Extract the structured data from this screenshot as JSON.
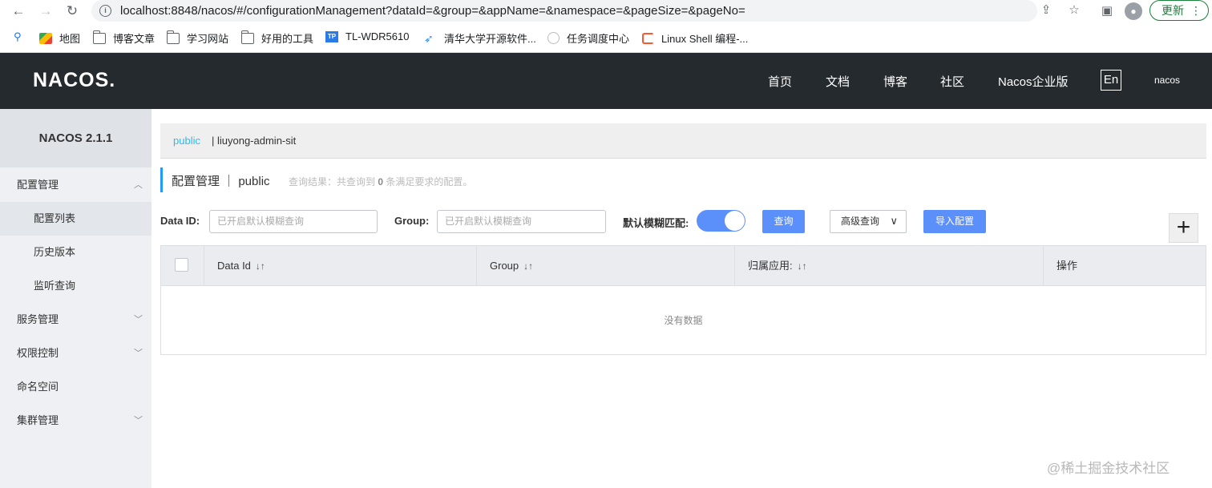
{
  "browser": {
    "url": "localhost:8848/nacos/#/configurationManagement?dataId=&group=&appName=&namespace=&pageSize=&pageNo=",
    "update_label": "更新",
    "bookmarks": [
      "地图",
      "博客文章",
      "学习网站",
      "好用的工具",
      "TL-WDR5610",
      "清华大学开源软件...",
      "任务调度中心",
      "Linux Shell 编程-..."
    ]
  },
  "header": {
    "logo": "NACOS.",
    "nav": [
      "首页",
      "文档",
      "博客",
      "社区",
      "Nacos企业版"
    ],
    "lang": "En",
    "user": "nacos"
  },
  "sidebar": {
    "version": "NACOS 2.1.1",
    "items": [
      "配置管理",
      "配置列表",
      "历史版本",
      "监听查询",
      "服务管理",
      "权限控制",
      "命名空间",
      "集群管理"
    ]
  },
  "namespace": {
    "active": "public",
    "other": "| liuyong-admin-sit"
  },
  "page": {
    "title": "配置管理 ｜ public",
    "result_prefix": "查询结果：共查询到 ",
    "result_count": "0",
    "result_suffix": " 条满足要求的配置。"
  },
  "filters": {
    "dataid_label": "Data ID:",
    "dataid_placeholder": "已开启默认模糊查询",
    "group_label": "Group:",
    "group_placeholder": "已开启默认模糊查询",
    "fuzzy_label": "默认模糊匹配:",
    "fuzzy_on": true,
    "query_btn": "查询",
    "advanced_btn": "高级查询",
    "import_btn": "导入配置"
  },
  "table": {
    "columns": [
      "Data Id",
      "Group",
      "归属应用:",
      "操作"
    ],
    "empty_text": "没有数据"
  },
  "watermark": "@稀土掘金技术社区"
}
